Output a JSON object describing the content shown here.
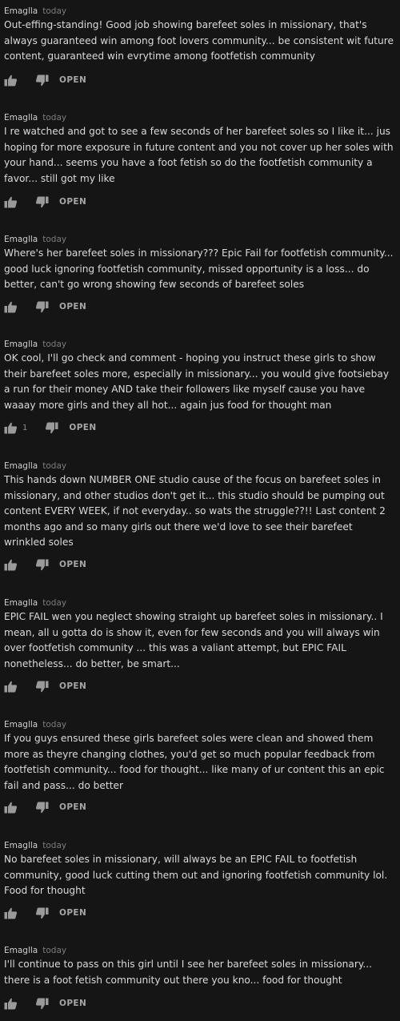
{
  "comments": [
    {
      "author": "Emaglla",
      "time": "today",
      "text": "Out-effing-standing! Good job showing barefeet soles in missionary, that's always guaranteed win among foot lovers community... be consistent wit future content, guaranteed win evrytime among footfetish community",
      "likes": "",
      "open_label": "OPEN"
    },
    {
      "author": "Emaglla",
      "time": "today",
      "text": "I re watched and got to see a few seconds of her barefeet soles so I like it... jus hoping for more exposure in future content and you not cover up her soles with your hand... seems you have a foot fetish so do the footfetish community a favor... still got my like",
      "likes": "",
      "open_label": "OPEN"
    },
    {
      "author": "Emaglla",
      "time": "today",
      "text": "Where's her barefeet soles in missionary??? Epic Fail for footfetish community... good luck ignoring footfetish community, missed opportunity is a loss... do better, can't go wrong showing few seconds of barefeet soles",
      "likes": "",
      "open_label": "OPEN"
    },
    {
      "author": "Emaglla",
      "time": "today",
      "text": "OK cool, I'll go check and comment - hoping you instruct these girls to show their barefeet soles more, especially in missionary... you would give footsiebay a run for their money AND take their followers like myself cause you have waaay more girls and they all hot... again jus food for thought man",
      "likes": "1",
      "open_label": "OPEN"
    },
    {
      "author": "Emaglla",
      "time": "today",
      "text": "This hands down NUMBER ONE studio cause of the focus on barefeet soles in missionary, and other studios don't get it... this studio should be pumping out content EVERY WEEK, if not everyday.. so wats the struggle??!! Last content 2 months ago and so many girls out there we'd love to see their barefeet wrinkled soles",
      "likes": "",
      "open_label": "OPEN"
    },
    {
      "author": "Emaglla",
      "time": "today",
      "text": "EPIC FAIL wen you neglect showing straight up barefeet soles in missionary.. I mean, all u gotta do is show it, even for few seconds and you will always win over footfetish community ... this was a valiant attempt, but EPIC FAIL nonetheless... do better, be smart...",
      "likes": "",
      "open_label": "OPEN"
    },
    {
      "author": "Emaglla",
      "time": "today",
      "text": "If you guys ensured these girls barefeet soles were clean and showed them more as theyre changing clothes, you'd get so much popular feedback from footfetish community... food for thought... like many of ur content this an epic fail and pass... do better",
      "likes": "",
      "open_label": "OPEN"
    },
    {
      "author": "Emaglla",
      "time": "today",
      "text": "No barefeet soles in missionary, will always be an EPIC FAIL to footfetish community, good luck cutting them out and ignoring footfetish community lol. Food for thought",
      "likes": "",
      "open_label": "OPEN"
    },
    {
      "author": "Emaglla",
      "time": "today",
      "text": "I'll continue to pass on this girl until I see her barefeet soles in missionary... there is a foot fetish community out there you kno... food for thought",
      "likes": "",
      "open_label": "OPEN"
    }
  ]
}
